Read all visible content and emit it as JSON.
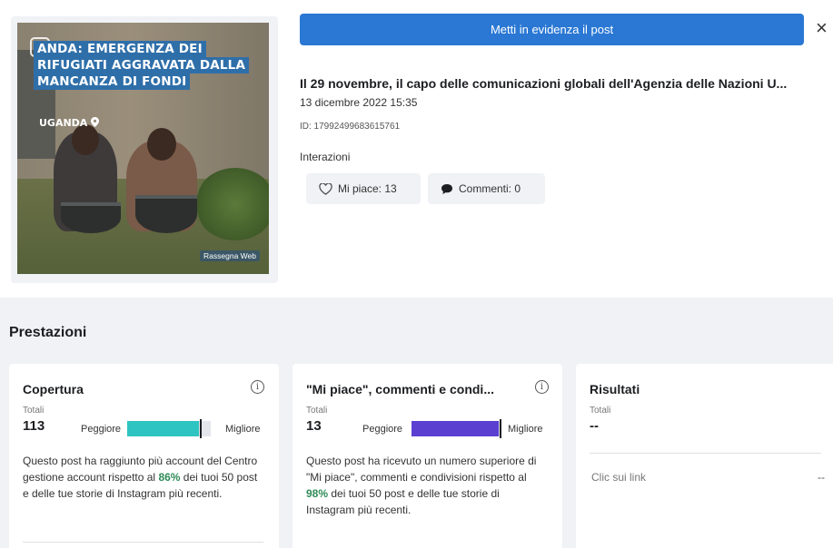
{
  "post": {
    "image_headline": [
      "ANDA: EMERGENZA DEI",
      "RIFUGIATI AGGRAVATA DALLA",
      "MANCANZA DI FONDI"
    ],
    "image_location": "UGANDA",
    "image_source": "Rassegna Web",
    "promote_label": "Metti in evidenza il post",
    "close_label": "×",
    "title": "Il 29 novembre, il capo delle comunicazioni globali dell'Agenzia delle Nazioni U...",
    "date": "13 dicembre 2022 15:35",
    "id": "ID: 17992499683615761",
    "interactions_label": "Interazioni",
    "likes_label": "Mi piace: 13",
    "comments_label": "Commenti: 0"
  },
  "performance": {
    "section_title": "Prestazioni",
    "cards": [
      {
        "title": "Copertura",
        "total_label": "Totali",
        "total_value": "113",
        "worse_label": "Peggiore",
        "better_label": "Migliore",
        "bar_fraction": 0.86,
        "bar_color": "#2ec4c1",
        "desc_before": "Questo post ha raggiunto più account del Centro gestione account rispetto al ",
        "pct": "86%",
        "desc_after": " dei tuoi 50 post e delle tue storie di Instagram più recenti."
      },
      {
        "title": "\"Mi piace\", commenti e condi...",
        "total_label": "Totali",
        "total_value": "13",
        "worse_label": "Peggiore",
        "better_label": "Migliore",
        "bar_fraction": 0.98,
        "bar_color": "#5b3fd1",
        "desc_before": "Questo post ha ricevuto un numero superiore di \"Mi piace\", commenti e condivisioni rispetto al ",
        "pct": "98%",
        "desc_after": " dei tuoi 50 post e delle tue storie di Instagram più recenti."
      },
      {
        "title": "Risultati",
        "total_label": "Totali",
        "total_value": "--",
        "links_label": "Clic sui link",
        "links_value": "--"
      }
    ]
  },
  "colors": {
    "primary_button": "#2a78d4",
    "positive_pct": "#2e8b57"
  }
}
